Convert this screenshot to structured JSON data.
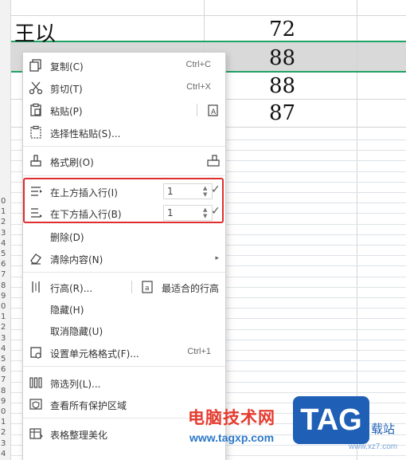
{
  "sheet": {
    "rows": [
      {
        "name": "王以",
        "score": "72"
      },
      {
        "name": "",
        "score": "88"
      },
      {
        "name": "",
        "score": "88"
      },
      {
        "name": "",
        "score": "87"
      }
    ],
    "row_numbers": [
      "0",
      "1",
      "2",
      "3",
      "4",
      "5",
      "6",
      "7",
      "8",
      "9",
      "0",
      "1",
      "2",
      "3",
      "4",
      "5",
      "6",
      "7",
      "8",
      "9",
      "0",
      "1",
      "2",
      "3",
      "4",
      "5"
    ],
    "accent_color": "#21a366"
  },
  "menu": {
    "copy": {
      "label": "复制(C)",
      "shortcut": "Ctrl+C",
      "icon": "copy-icon"
    },
    "cut": {
      "label": "剪切(T)",
      "shortcut": "Ctrl+X",
      "icon": "scissors-icon"
    },
    "paste": {
      "label": "粘贴(P)",
      "icon": "paste-icon"
    },
    "paste_special": {
      "label": "选择性粘贴(S)...",
      "icon": "paste-special-icon"
    },
    "format_painter": {
      "label": "格式刷(O)",
      "icon": "format-painter-icon"
    },
    "insert_above": {
      "label": "在上方插入行(I)",
      "value": "1",
      "icon": "insert-row-above-icon"
    },
    "insert_below": {
      "label": "在下方插入行(B)",
      "value": "1",
      "icon": "insert-row-below-icon"
    },
    "delete": {
      "label": "删除(D)"
    },
    "clear": {
      "label": "清除内容(N)",
      "icon": "eraser-icon"
    },
    "row_height": {
      "label": "行高(R)...",
      "icon": "row-height-icon"
    },
    "best_fit": {
      "label": "最适合的行高",
      "icon": "best-fit-icon"
    },
    "hide": {
      "label": "隐藏(H)"
    },
    "unhide": {
      "label": "取消隐藏(U)"
    },
    "format_cells": {
      "label": "设置单元格格式(F)...",
      "shortcut": "Ctrl+1",
      "icon": "format-cells-icon"
    },
    "filter_col": {
      "label": "筛选列(L)...",
      "icon": "filter-column-icon"
    },
    "protect": {
      "label": "查看所有保护区域",
      "icon": "shield-icon"
    },
    "beautify": {
      "label": "表格整理美化",
      "icon": "table-beautify-icon"
    },
    "highlight_color": "#e02d2d"
  },
  "watermark": {
    "site_cn": "电脑技术网",
    "url": "www.tagxp.com",
    "tag": "TAG",
    "site_suffix": "载站",
    "site_suffix2": "www.xz7.com"
  }
}
